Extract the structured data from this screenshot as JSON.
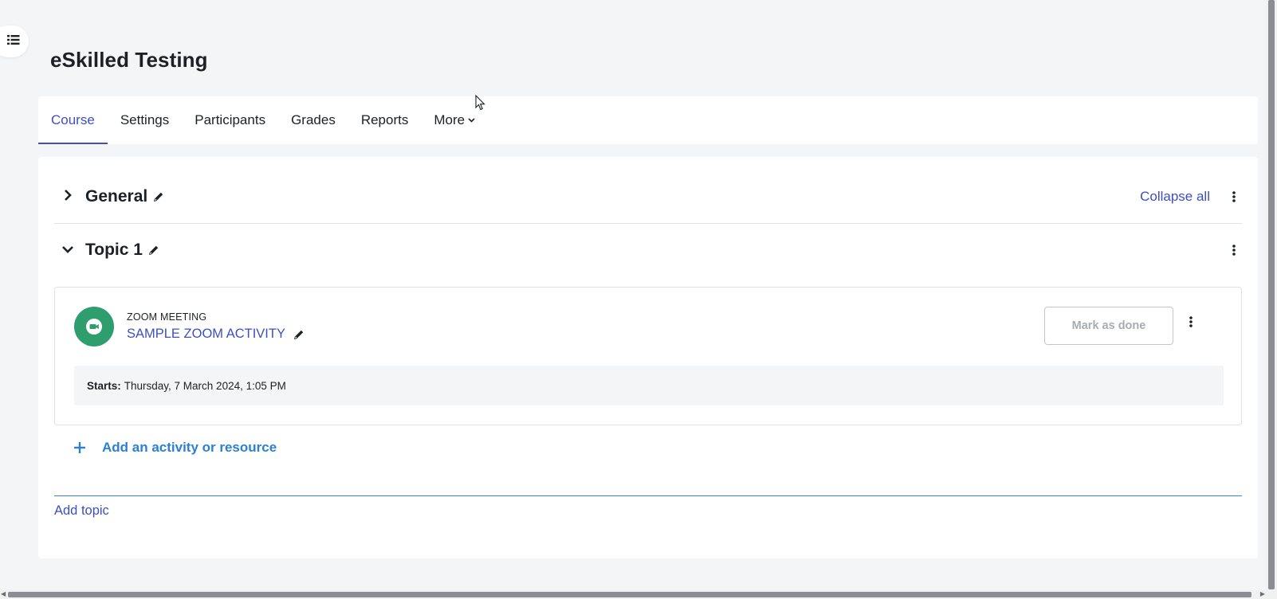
{
  "course": {
    "title": "eSkilled Testing"
  },
  "nav": {
    "tabs": [
      {
        "label": "Course",
        "active": true
      },
      {
        "label": "Settings",
        "active": false
      },
      {
        "label": "Participants",
        "active": false
      },
      {
        "label": "Grades",
        "active": false
      },
      {
        "label": "Reports",
        "active": false
      },
      {
        "label": "More",
        "active": false,
        "has_dropdown": true
      }
    ]
  },
  "sections": {
    "general": {
      "title": "General",
      "expanded": false
    },
    "topic1": {
      "title": "Topic 1",
      "expanded": true
    },
    "collapse_all_label": "Collapse all"
  },
  "activity": {
    "type_label": "ZOOM MEETING",
    "name": "SAMPLE ZOOM ACTIVITY",
    "mark_done_label": "Mark as done",
    "starts_label": "Starts:",
    "starts_value": "Thursday, 7 March 2024, 1:05 PM",
    "icon": "video-camera-icon",
    "icon_color": "#2f9e6e"
  },
  "actions": {
    "add_activity_label": "Add an activity or resource",
    "add_topic_label": "Add topic"
  },
  "colors": {
    "link": "#3d4fc2",
    "accent_blue": "#2b7fd6",
    "background": "#f4f5f7"
  }
}
